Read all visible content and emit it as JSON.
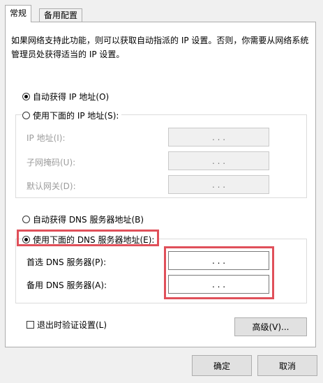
{
  "tabs": [
    "常规",
    "备用配置"
  ],
  "description": "如果网络支持此功能，则可以获取自动指派的 IP 设置。否则，你需要从网络系统管理员处获得适当的 IP 设置。",
  "ip_section": {
    "auto_option": "自动获得 IP 地址(O)",
    "manual_option": "使用下面的 IP 地址(S):",
    "fields": [
      {
        "label": "IP 地址(I):",
        "value": ".   .   ."
      },
      {
        "label": "子网掩码(U):",
        "value": ".   .   ."
      },
      {
        "label": "默认网关(D):",
        "value": ".   .   ."
      }
    ]
  },
  "dns_section": {
    "auto_option": "自动获得 DNS 服务器地址(B)",
    "manual_option": "使用下面的 DNS 服务器地址(E):",
    "fields": [
      {
        "label": "首选 DNS 服务器(P):",
        "value": ".   .   ."
      },
      {
        "label": "备用 DNS 服务器(A):",
        "value": ".   .   ."
      }
    ]
  },
  "validate_checkbox": "退出时验证设置(L)",
  "advanced_button": "高级(V)...",
  "ok_button": "确定",
  "cancel_button": "取消",
  "colors": {
    "highlight": "#e0505a"
  },
  "state": {
    "ip_mode": "auto",
    "dns_mode": "manual",
    "validate_on_exit": false
  }
}
